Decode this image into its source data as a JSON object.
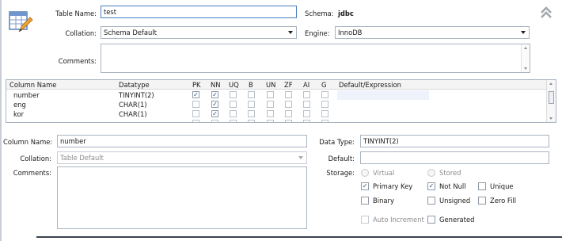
{
  "table": {
    "name_label": "Table Name:",
    "name_value": "test",
    "schema_label": "Schema:",
    "schema_value": "jdbc",
    "collation_label": "Collation:",
    "collation_value": "Schema Default",
    "engine_label": "Engine:",
    "engine_value": "InnoDB",
    "comments_label": "Comments:",
    "comments_value": "",
    "icon": "table-edit-icon",
    "collapse_icon": "chevrons-up-icon"
  },
  "grid": {
    "headers": {
      "column_name": "Column Name",
      "datatype": "Datatype",
      "pk": "PK",
      "nn": "NN",
      "uq": "UQ",
      "b": "B",
      "un": "UN",
      "zf": "ZF",
      "ai": "AI",
      "g": "G",
      "default": "Default/Expression"
    },
    "rows": [
      {
        "name": "number",
        "datatype": "TINYINT(2)",
        "pk": true,
        "nn": true,
        "uq": false,
        "b": false,
        "un": false,
        "zf": false,
        "ai": false,
        "g": false,
        "default": ""
      },
      {
        "name": "eng",
        "datatype": "CHAR(1)",
        "pk": false,
        "nn": true,
        "uq": false,
        "b": false,
        "un": false,
        "zf": false,
        "ai": false,
        "g": false,
        "default": ""
      },
      {
        "name": "kor",
        "datatype": "CHAR(1)",
        "pk": false,
        "nn": true,
        "uq": false,
        "b": false,
        "un": false,
        "zf": false,
        "ai": false,
        "g": false,
        "default": ""
      }
    ]
  },
  "detail": {
    "column_name_label": "Column Name:",
    "column_name_value": "number",
    "collation_label": "Collation:",
    "collation_value": "Table Default",
    "comments_label": "Comments:",
    "comments_value": "",
    "data_type_label": "Data Type:",
    "data_type_value": "TINYINT(2)",
    "default_label": "Default:",
    "default_value": "",
    "storage_label": "Storage:",
    "virtual_label": "Virtual",
    "stored_label": "Stored",
    "primary_key_label": "Primary Key",
    "primary_key": true,
    "not_null_label": "Not Null",
    "not_null": true,
    "unique_label": "Unique",
    "unique": false,
    "binary_label": "Binary",
    "binary": false,
    "unsigned_label": "Unsigned",
    "unsigned": false,
    "zero_fill_label": "Zero Fill",
    "zero_fill": false,
    "auto_increment_label": "Auto Increment",
    "auto_increment": false,
    "generated_label": "Generated",
    "generated": false
  },
  "check_glyph": "✓"
}
